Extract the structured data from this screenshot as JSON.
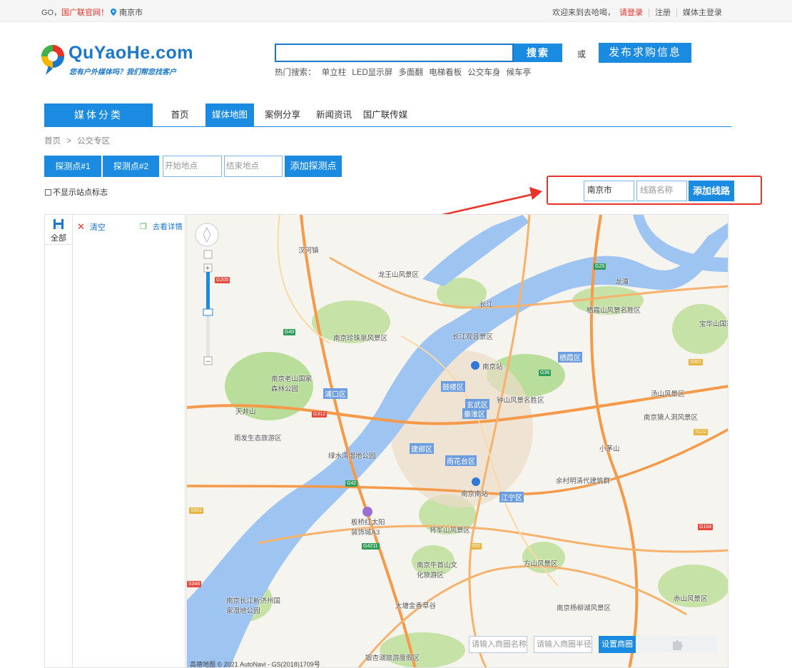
{
  "topbar": {
    "go_text": "GO，",
    "go_link": "国广联官网！",
    "city": "南京市",
    "welcome": "欢迎来到去哈喝，",
    "login": "请登录",
    "register": "注册",
    "media_login": "媒体主登录"
  },
  "logo": {
    "name": "QuYaoHe.com",
    "slogan": "您有户外媒体吗？我们帮您找客户"
  },
  "search": {
    "value": "",
    "button": "搜索",
    "or": "或",
    "publish": "发布求购信息"
  },
  "hot": {
    "label": "热门搜索：",
    "items": [
      "单立柱",
      "LED显示屏",
      "多面翻",
      "电梯看板",
      "公交车身",
      "候车亭"
    ]
  },
  "nav": {
    "category": "媒体分类",
    "items": [
      "首页",
      "媒体地图",
      "案例分享",
      "新闻资讯",
      "国广联传媒"
    ]
  },
  "breadcrumb": {
    "home": "首页",
    "sep": ">",
    "current": "公交专区"
  },
  "tools": {
    "probe1": "探测点#1",
    "probe2": "探测点#2",
    "start_placeholder": "开始地点",
    "end_placeholder": "结束地点",
    "add_probe": "添加探测点",
    "hide_station": "不显示站点标志",
    "line_city": "南京市",
    "line_name_placeholder": "线路名称",
    "add_line": "添加线路"
  },
  "panel": {
    "all": "全部",
    "clear": "清空",
    "detail": "去看详情"
  },
  "map": {
    "labels": {
      "longwang": "龙王山风景区",
      "qixia": "栖霞山风景名胜区",
      "baohua": "宝华山国家森林公园",
      "zhenzhu": "南京珍珠泉风景区",
      "changjiangguan": "长江观音景区",
      "laoshan": "南京老山国家森林公园",
      "tianjing": "天井山",
      "yuhua": "雨发生态旅游区",
      "lushui": "绿水湾湿地公园",
      "zhongshan": "钟山风景名胜区",
      "tangshan": "汤山风景区",
      "yuanren": "南京猿人洞风景区",
      "xiaomao": "小茅山",
      "yucun": "余村明清代建筑群",
      "banqiao": "板桥红太阳装饰城A3",
      "jiangjun": "将军山风景区",
      "niushou": "南京牛首山文化旅游区",
      "fangshan": "方山风景区",
      "changjiangxinji": "南京长江新济州国家湿地公园",
      "datang": "大塘金香草谷",
      "yinxing": "银杏湖旅游度假区",
      "yangliu": "南京杨柳湖风景区",
      "chishan": "赤山风景区",
      "nanjingzhan": "南京站",
      "nanjingnan": "南京南站",
      "yangzi": "长江",
      "longtan": "龙潭",
      "shanghe": "汊河镇"
    },
    "districts": [
      "浦口区",
      "鼓楼区",
      "玄武区",
      "秦淮区",
      "建邺区",
      "雨花台区",
      "江宁区",
      "栖霞区"
    ],
    "shields": [
      "G40",
      "G36",
      "G25",
      "G312",
      "G42",
      "G4211",
      "S002",
      "S122",
      "S001",
      "G104",
      "S346",
      "555",
      "G205"
    ],
    "store_name_placeholder": "请输入商圈名称",
    "store_radius_placeholder": "请输入商圈半径",
    "set_store": "设置商圈",
    "copyright": "高德地图 © 2021 AutoNavi - GS(2018)1709号"
  }
}
